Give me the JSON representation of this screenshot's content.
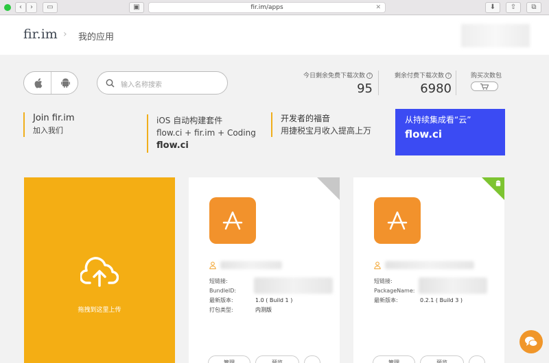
{
  "browser": {
    "url": "fir.im/apps",
    "icons": [
      "sidebar-icon",
      "reader-icon",
      "download-icon",
      "share-icon",
      "tabs-icon"
    ]
  },
  "header": {
    "logo": "fir.im",
    "breadcrumb_sep": "›",
    "breadcrumb": "我的应用"
  },
  "toolbar": {
    "platforms": [
      "apple-icon",
      "android-icon"
    ],
    "search_placeholder": "输入名称搜索"
  },
  "stats": {
    "free_label": "今日剩余免费下载次数",
    "free_value": "95",
    "paid_label": "剩余付费下载次数",
    "paid_value": "6980",
    "buy_label": "购买次数包"
  },
  "promos": [
    {
      "line1": "Join fir.im",
      "line2": "加入我们"
    },
    {
      "line1": "iOS 自动构建套件",
      "line2": "flow.ci + fir.im + Coding",
      "line3": "flow.ci"
    },
    {
      "line1": "开发者的福音",
      "line2": "用捷税宝月收入提高上万"
    }
  ],
  "featured": {
    "line1": "从持续集成看“云”",
    "line2": "flow.ci",
    "color": "#3b4bf3"
  },
  "upload": {
    "label": "拖拽到这里上传",
    "color": "#f4ae14"
  },
  "apps": [
    {
      "platform": "ios",
      "corner_color": "#c8c8c8",
      "short_label": "短链接:",
      "id_label": "BundleID:",
      "version_label": "最新版本:",
      "version": "1.0 ( Build 1 )",
      "type_label": "打包类型:",
      "type": "内测版"
    },
    {
      "platform": "android",
      "corner_color": "#7dc431",
      "short_label": "短链接:",
      "id_label": "PackageName:",
      "version_label": "最新版本:",
      "version": "0.2.1 ( Build 3 )"
    }
  ],
  "app_buttons": [
    "管理",
    "预览"
  ],
  "accent": "#f2922c"
}
